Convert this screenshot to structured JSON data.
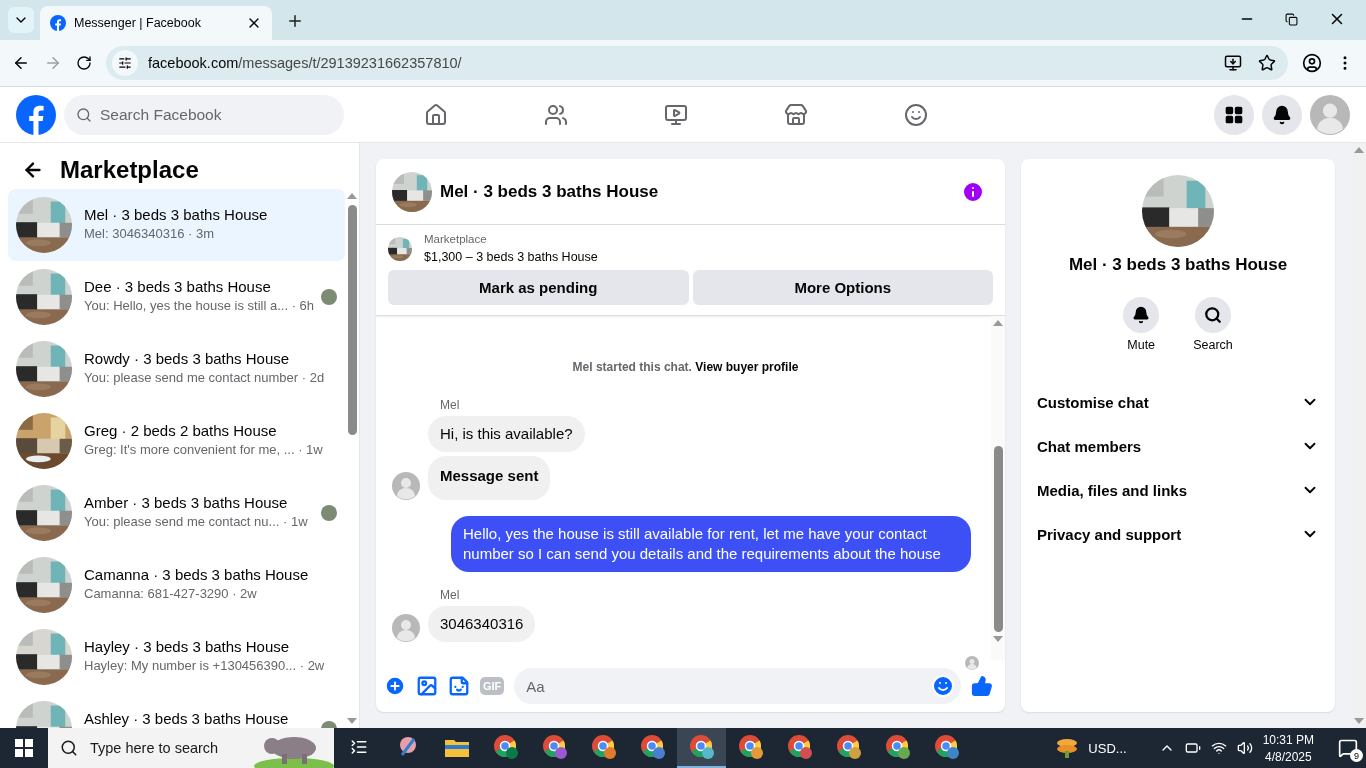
{
  "browser": {
    "tabs": [
      {
        "title": "Messenger | Facebook",
        "selected": true
      }
    ],
    "url_host": "facebook.com",
    "url_path": "/messages/t/29139231662357810/"
  },
  "nav": {
    "search_placeholder": "Search Facebook"
  },
  "sidebar": {
    "title": "Marketplace",
    "conversations": [
      {
        "name": "Mel · 3 beds 3 baths House",
        "meta": "Mel: 3046340316 · 3m",
        "selected": true,
        "seen": false
      },
      {
        "name": "Dee · 3 beds 3 baths House",
        "meta": "You: Hello, yes the house is still a... · 6h",
        "selected": false,
        "seen": true
      },
      {
        "name": "Rowdy · 3 beds 3 baths House",
        "meta": "You: please send me contact number · 2d",
        "selected": false,
        "seen": false
      },
      {
        "name": "Greg · 2 beds 2 baths House",
        "meta": "Greg: It's more convenient for me, ... · 1w",
        "selected": false,
        "seen": false
      },
      {
        "name": "Amber · 3 beds 3 baths House",
        "meta": "You: please send me contact nu... · 1w",
        "selected": false,
        "seen": true
      },
      {
        "name": "Camanna · 3 beds 3 baths House",
        "meta": "Camanna: 681-427-3290 · 2w",
        "selected": false,
        "seen": false
      },
      {
        "name": "Hayley · 3 beds 3 baths House",
        "meta": "Hayley: My number is +130456390... · 2w",
        "selected": false,
        "seen": false
      },
      {
        "name": "Ashley · 3 beds 3 baths House",
        "selected": false,
        "seen": true
      }
    ]
  },
  "chat": {
    "title": "Mel · 3 beds 3 baths House",
    "listing": {
      "label": "Marketplace",
      "title": "$1,300 – 3 beds 3 baths House"
    },
    "actions": [
      "Mark as pending",
      "More Options"
    ],
    "notice": {
      "text": "Mel started this chat.",
      "link": "View buyer profile"
    },
    "messages": [
      {
        "kind": "sender",
        "text": "Mel"
      },
      {
        "kind": "incoming",
        "text": "Hi, is this available?",
        "avatar": false,
        "bold": false
      },
      {
        "kind": "incoming",
        "text": "Message sent",
        "avatar": true,
        "bold": true
      },
      {
        "kind": "outgoing",
        "text": "Hello, yes the house is still available for rent, let me have your contact number so I can send you details and the requirements about the house"
      },
      {
        "kind": "sender",
        "text": "Mel"
      },
      {
        "kind": "incoming",
        "text": "3046340316",
        "avatar": true,
        "bold": false
      },
      {
        "kind": "seen"
      }
    ],
    "gif_label": "GIF",
    "composer_placeholder": "Aa"
  },
  "info": {
    "title": "Mel · 3 beds 3 baths House",
    "actions": [
      {
        "kind": "bell",
        "label": "Mute"
      },
      {
        "kind": "search",
        "label": "Search"
      }
    ],
    "sections": [
      "Customise chat",
      "Chat members",
      "Media, files and links",
      "Privacy and support"
    ]
  },
  "taskbar": {
    "search_placeholder": "Type here to search",
    "apps": [
      {
        "kind": "taskview",
        "selected": false
      },
      {
        "kind": "snip",
        "selected": false
      },
      {
        "kind": "folder",
        "selected": false
      },
      {
        "kind": "chrome",
        "selected": false,
        "color": "#0b7a4a"
      },
      {
        "kind": "chrome",
        "selected": false,
        "color": "#9b59d0"
      },
      {
        "kind": "chrome",
        "selected": false,
        "color": "#e07a2c"
      },
      {
        "kind": "chrome",
        "selected": false,
        "color": "#4a7ed0"
      },
      {
        "kind": "chrome",
        "selected": true,
        "color": "#56b8c8"
      },
      {
        "kind": "chrome",
        "selected": false,
        "color": "#e39a3b"
      },
      {
        "kind": "chrome",
        "selected": false,
        "color": "#d05050"
      },
      {
        "kind": "chrome",
        "selected": false,
        "color": "#d0a040"
      },
      {
        "kind": "chrome",
        "selected": false,
        "color": "#6aa84f"
      },
      {
        "kind": "chrome",
        "selected": false,
        "color": "#3d85c6"
      }
    ],
    "tray_label": "USD...",
    "time": "10:31 PM",
    "date": "4/8/2025",
    "notifications": "9"
  }
}
